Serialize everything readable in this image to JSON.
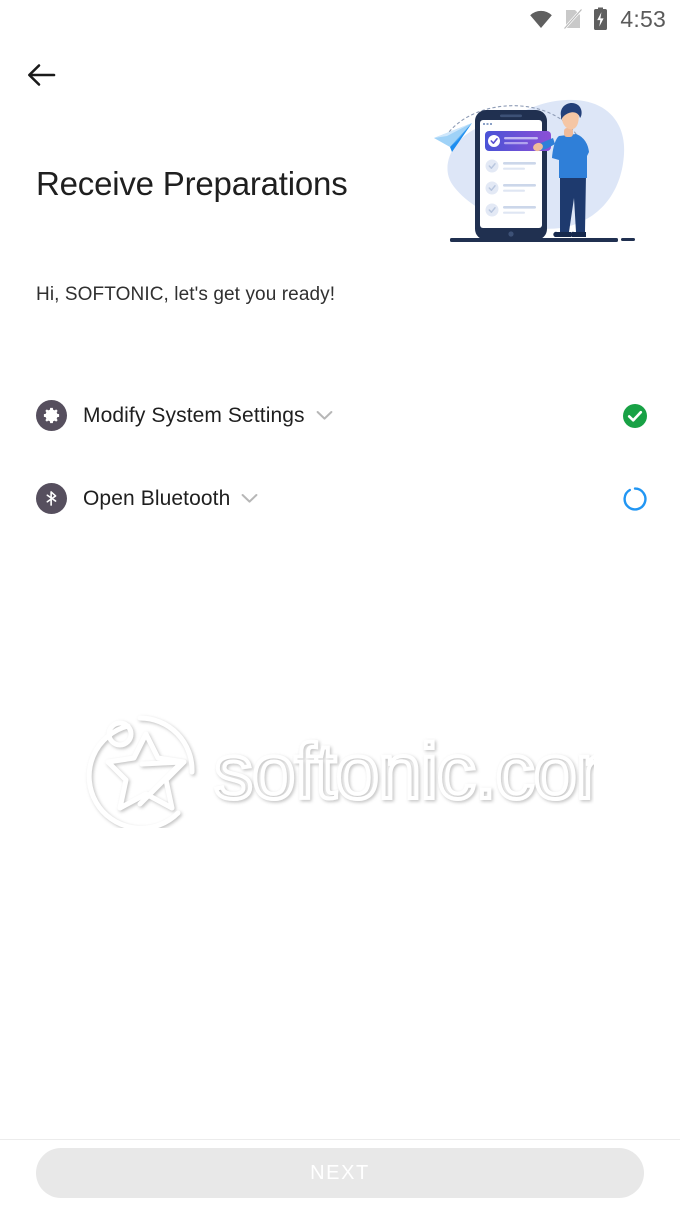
{
  "statusbar": {
    "wifi_icon": "wifi-icon",
    "sim_icon": "sim-card-disabled-icon",
    "battery_icon": "battery-charging-icon",
    "time": "4:53"
  },
  "header": {
    "back_icon": "arrow-left-icon",
    "title": "Receive Preparations",
    "illustration_name": "checklist-phone-illustration"
  },
  "main": {
    "greeting": "Hi, SOFTONIC, let's get you ready!",
    "permissions": [
      {
        "icon": "gear-icon",
        "label": "Modify System Settings",
        "chevron": "chevron-down-icon",
        "status": "complete",
        "status_icon": "check-circle-icon"
      },
      {
        "icon": "bluetooth-icon",
        "label": "Open Bluetooth",
        "chevron": "chevron-down-icon",
        "status": "loading",
        "status_icon": "spinner-icon"
      }
    ]
  },
  "watermark": {
    "text": "softonic.com",
    "logo_name": "softonic-star-logo"
  },
  "footer": {
    "next_label": "NEXT",
    "next_enabled": false
  },
  "colors": {
    "accent_green": "#18a145",
    "accent_blue": "#2196f3",
    "icon_circle": "#564f5e",
    "text_primary": "#1f1f1f",
    "button_disabled_bg": "#e8e8e8",
    "illustration_blob": "#dde6f7"
  }
}
